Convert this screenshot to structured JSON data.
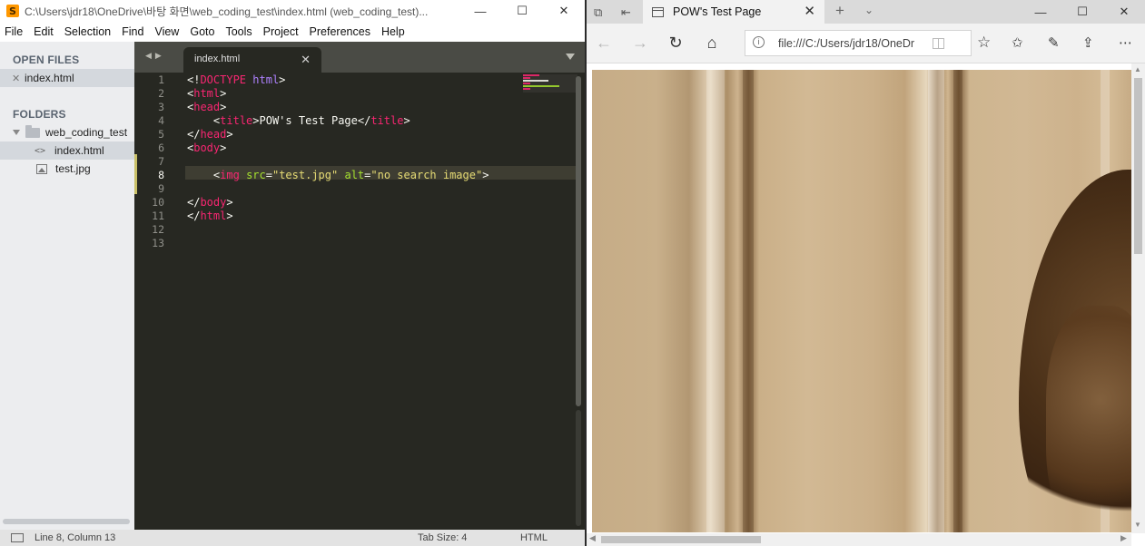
{
  "sublime": {
    "window_title": "C:\\Users\\jdr18\\OneDrive\\바탕 화면\\web_coding_test\\index.html (web_coding_test)...",
    "menu": [
      "File",
      "Edit",
      "Selection",
      "Find",
      "View",
      "Goto",
      "Tools",
      "Project",
      "Preferences",
      "Help"
    ],
    "sidebar": {
      "open_files_heading": "OPEN FILES",
      "open_files": [
        "index.html"
      ],
      "folders_heading": "FOLDERS",
      "folder": "web_coding_test",
      "files": [
        "index.html",
        "test.jpg"
      ]
    },
    "tab_label": "index.html",
    "line_numbers": [
      "1",
      "2",
      "3",
      "4",
      "5",
      "6",
      "7",
      "8",
      "9",
      "10",
      "11",
      "12",
      "13"
    ],
    "code": {
      "l1_a": "<!",
      "l1_b": "DOCTYPE",
      "l1_c": " ",
      "l1_d": "html",
      "l1_e": ">",
      "l2_a": "<",
      "l2_b": "html",
      "l2_c": ">",
      "l3_a": "<",
      "l3_b": "head",
      "l3_c": ">",
      "l4_indent": "    ",
      "l4_a": "<",
      "l4_b": "title",
      "l4_c": ">",
      "l4_text": "POW's Test Page",
      "l4_d": "</",
      "l4_e": "title",
      "l4_f": ">",
      "l5_a": "</",
      "l5_b": "head",
      "l5_c": ">",
      "l6_a": "<",
      "l6_b": "body",
      "l6_c": ">",
      "l8_indent": "    ",
      "l8_a": "<",
      "l8_b": "img",
      "l8_sp1": " ",
      "l8_attr1": "src",
      "l8_eq1": "=",
      "l8_val1": "\"test.jpg\"",
      "l8_sp2": " ",
      "l8_attr2": "alt",
      "l8_eq2": "=",
      "l8_val2": "\"no search image\"",
      "l8_c": ">",
      "l10_a": "</",
      "l10_b": "body",
      "l10_c": ">",
      "l11_a": "</",
      "l11_b": "html",
      "l11_c": ">"
    },
    "status": {
      "position": "Line 8, Column 13",
      "tab_size": "Tab Size: 4",
      "syntax": "HTML"
    }
  },
  "edge": {
    "tab_title": "POW's Test Page",
    "address": "file:///C:/Users/jdr18/OneDr",
    "image_alt": "no search image"
  },
  "colors": {
    "editor_bg": "#272822",
    "tag": "#f92672",
    "attr": "#a6e22e",
    "string": "#e6db74",
    "keyword": "#ae81ff"
  }
}
